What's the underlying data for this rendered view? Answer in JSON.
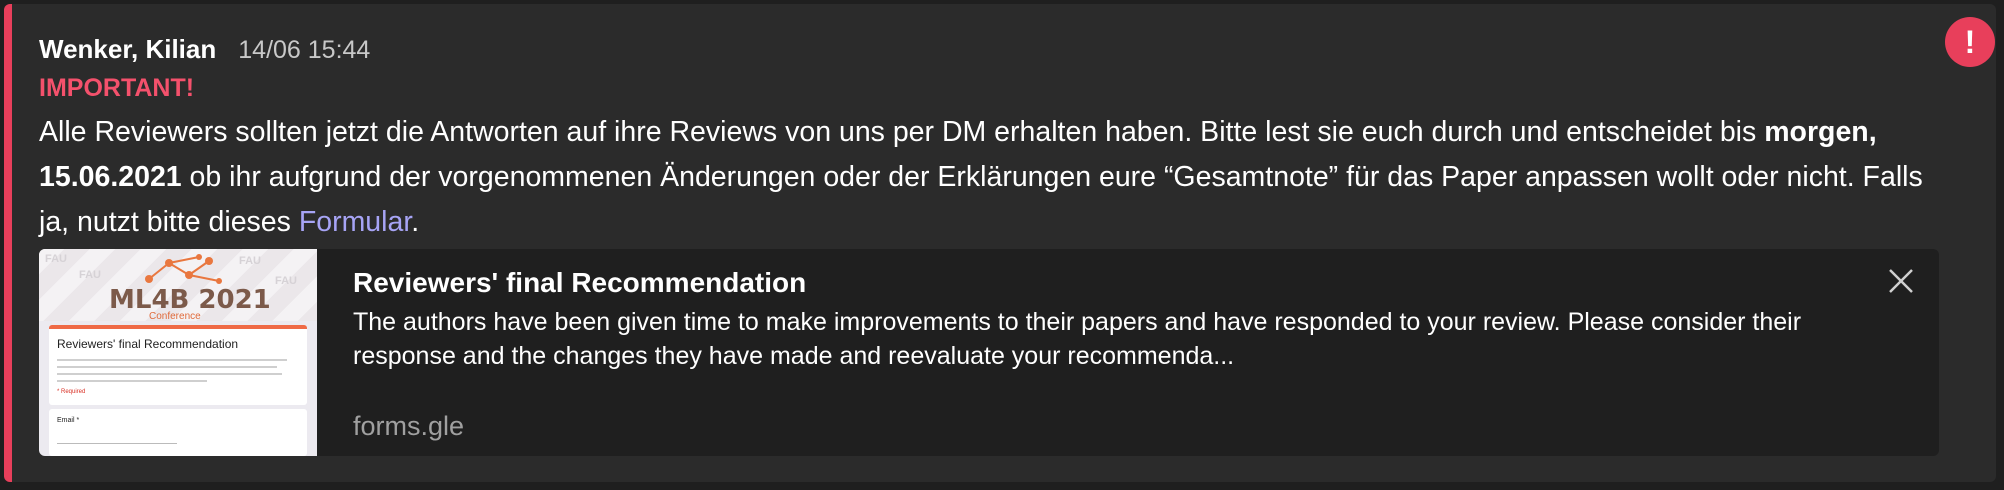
{
  "message": {
    "author": "Wenker, Kilian",
    "timestamp": "14/06 15:44",
    "importance": "IMPORTANT!",
    "body": {
      "part1": "Alle Reviewers sollten jetzt die Antworten auf ihre Reviews von uns per DM erhalten haben. Bitte lest sie euch durch und entscheidet bis ",
      "bold": "morgen, 15.06.2021",
      "part2": " ob ihr aufgrund der vorgenommenen Änderungen oder der Erklärungen eure “Gesamtnote” für das Paper anpassen wollt oder nicht. Falls ja, nutzt bitte dieses ",
      "link_text": "Formular",
      "part3": "."
    },
    "alert_icon": "exclamation-icon",
    "accent_color": "#e83f5b",
    "link_color": "#a7a4f5"
  },
  "link_preview": {
    "title": "Reviewers' final Recommendation",
    "description": "The authors have been given time to make improvements to their papers and have responded to your review. Please consider their response and the changes they have made and reevaluate your recommenda...",
    "domain": "forms.gle",
    "close_icon": "close-icon",
    "thumbnail": {
      "logo_text": "ML4B 2021",
      "logo_sub": "Conference",
      "watermark": "FAU",
      "form_title": "Reviewers' final Recommendation",
      "required_label": "* Required",
      "email_label": "Email *"
    }
  }
}
